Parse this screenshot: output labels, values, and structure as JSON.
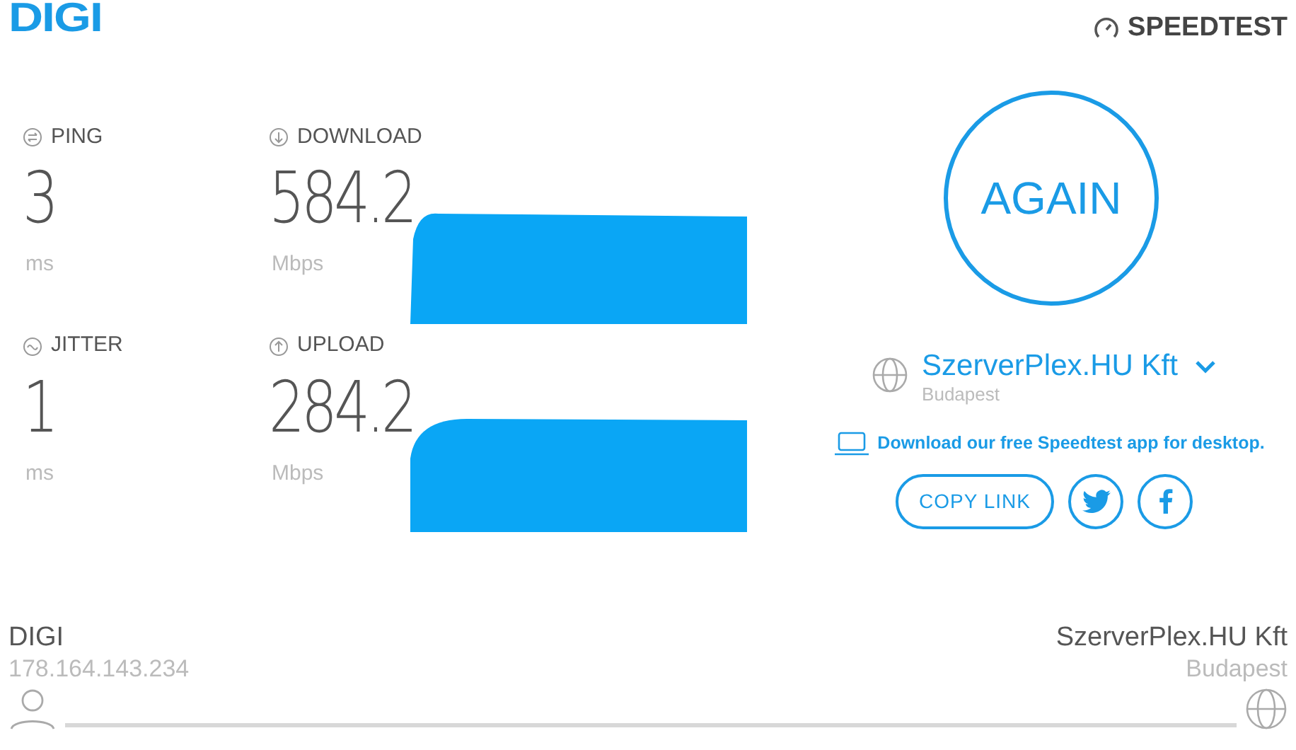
{
  "header": {
    "logo": "DIGI",
    "brand": "SPEEDTEST"
  },
  "metrics": [
    {
      "kind": "ping",
      "label": "PING",
      "value": "3",
      "unit": "ms"
    },
    {
      "kind": "download",
      "label": "DOWNLOAD",
      "value": "584.2",
      "unit": "Mbps"
    },
    {
      "kind": "jitter",
      "label": "JITTER",
      "value": "1",
      "unit": "ms"
    },
    {
      "kind": "upload",
      "label": "UPLOAD",
      "value": "284.2",
      "unit": "Mbps"
    }
  ],
  "again_button": "AGAIN",
  "server": {
    "name": "SzerverPlex.HU Kft",
    "city": "Budapest"
  },
  "desktop_link": "Download our free Speedtest app for desktop.",
  "copy_link": "COPY LINK",
  "footer": {
    "isp": "DIGI",
    "ip": "178.164.143.234",
    "server": "SzerverPlex.HU Kft",
    "city": "Budapest"
  }
}
